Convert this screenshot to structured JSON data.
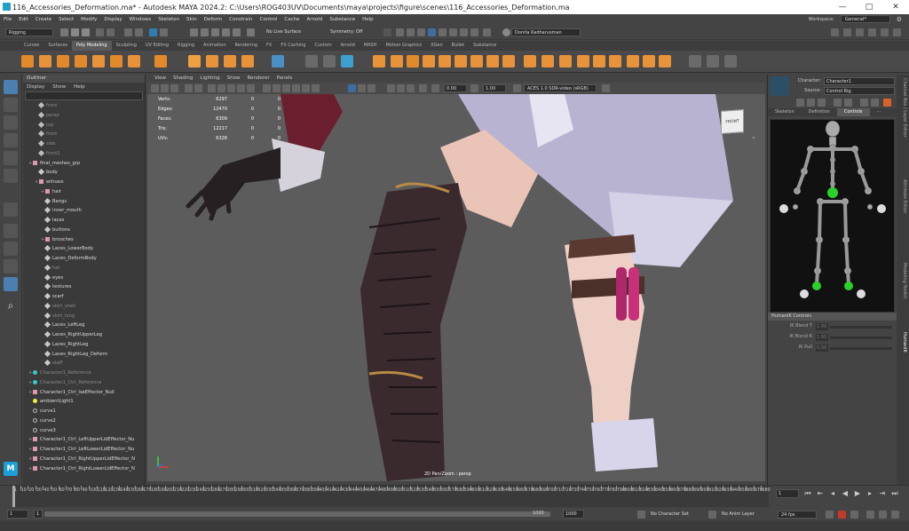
{
  "window": {
    "title": "116_Accessories_Deformation.ma* - Autodesk MAYA 2024.2: C:\\Users\\ROG403UV\\Documents\\maya\\projects\\figure\\scenes\\116_Accessories_Deformation.ma",
    "min": "—",
    "max": "□",
    "close": "✕"
  },
  "menus": [
    "File",
    "Edit",
    "Create",
    "Select",
    "Modify",
    "Display",
    "Windows",
    "Skeleton",
    "Skin",
    "Deform",
    "Constrain",
    "Control",
    "Cache",
    "Arnold",
    "Substance",
    "Help"
  ],
  "workspace": {
    "label": "Workspace:",
    "value": "General*"
  },
  "status_line": {
    "menu_set": "Rigging",
    "live_surface": "No Live Surface",
    "symmetry": "Symmetry: Off",
    "user": "Donita Kadharusman"
  },
  "shelf_tabs": [
    "Curves",
    "Surfaces",
    "Poly Modeling",
    "Sculpting",
    "UV Editing",
    "Rigging",
    "Animation",
    "Rendering",
    "FX",
    "FX Caching",
    "Custom",
    "Arnold",
    "MASH",
    "Motion Graphics",
    "XGen",
    "Bullet",
    "Substance"
  ],
  "shelf_active": "Poly Modeling",
  "outliner": {
    "title": "Outliner",
    "menu": [
      "Display",
      "Show",
      "Help"
    ],
    "rows": [
      {
        "label": "front",
        "depth": 1,
        "icon": "camera",
        "dim": true
      },
      {
        "label": "persp",
        "depth": 1,
        "icon": "camera",
        "dim": true
      },
      {
        "label": "top",
        "depth": 1,
        "icon": "camera",
        "dim": true
      },
      {
        "label": "front",
        "depth": 1,
        "icon": "camera",
        "dim": true
      },
      {
        "label": "side",
        "depth": 1,
        "icon": "camera",
        "dim": true
      },
      {
        "label": "front1",
        "depth": 1,
        "icon": "camera",
        "dim": true
      },
      {
        "label": "final_meshes_grp",
        "depth": 0,
        "icon": "grp",
        "dim": false
      },
      {
        "label": "body",
        "depth": 1,
        "icon": "mesh",
        "dim": false
      },
      {
        "label": "witnass",
        "depth": 1,
        "icon": "grp",
        "dim": false
      },
      {
        "label": "hair",
        "depth": 2,
        "icon": "grp",
        "dim": false
      },
      {
        "label": "Bangs",
        "depth": 2,
        "icon": "mesh",
        "dim": false
      },
      {
        "label": "inner_mouth",
        "depth": 2,
        "icon": "mesh",
        "dim": false
      },
      {
        "label": "laces",
        "depth": 2,
        "icon": "mesh",
        "dim": false
      },
      {
        "label": "buttons",
        "depth": 2,
        "icon": "mesh",
        "dim": false
      },
      {
        "label": "brooches",
        "depth": 2,
        "icon": "grp",
        "dim": false
      },
      {
        "label": "Laces_LowerBody",
        "depth": 2,
        "icon": "mesh",
        "dim": false
      },
      {
        "label": "Laces_DeformBody",
        "depth": 2,
        "icon": "mesh",
        "dim": false
      },
      {
        "label": "hat",
        "depth": 2,
        "icon": "mesh",
        "dim": true
      },
      {
        "label": "eyes",
        "depth": 2,
        "icon": "mesh",
        "dim": false
      },
      {
        "label": "textures",
        "depth": 2,
        "icon": "mesh",
        "dim": false
      },
      {
        "label": "scarf",
        "depth": 2,
        "icon": "mesh",
        "dim": false
      },
      {
        "label": "skirt_shell",
        "depth": 2,
        "icon": "mesh",
        "dim": true
      },
      {
        "label": "skirt_long",
        "depth": 2,
        "icon": "mesh",
        "dim": true
      },
      {
        "label": "Laces_LeftLeg",
        "depth": 2,
        "icon": "mesh",
        "dim": false
      },
      {
        "label": "Laces_RightUpperLeg",
        "depth": 2,
        "icon": "mesh",
        "dim": false
      },
      {
        "label": "Laces_RightLeg",
        "depth": 2,
        "icon": "mesh",
        "dim": false
      },
      {
        "label": "Laces_RightLeg_Deform",
        "depth": 2,
        "icon": "mesh",
        "dim": false
      },
      {
        "label": "staff",
        "depth": 2,
        "icon": "mesh",
        "dim": true
      },
      {
        "label": "Character1_Reference",
        "depth": 0,
        "icon": "joint",
        "dim": true
      },
      {
        "label": "Character1_Ctrl_Reference",
        "depth": 0,
        "icon": "joint",
        "dim": true
      },
      {
        "label": "Character1_Ctrl_IseEffector_Null",
        "depth": 0,
        "icon": "grp",
        "dim": false
      },
      {
        "label": "ambientLight1",
        "depth": 0,
        "icon": "light",
        "dim": false
      },
      {
        "label": "curve1",
        "depth": 0,
        "icon": "curve",
        "dim": false
      },
      {
        "label": "curve2",
        "depth": 0,
        "icon": "curve",
        "dim": false
      },
      {
        "label": "curve3",
        "depth": 0,
        "icon": "curve",
        "dim": false
      },
      {
        "label": "Character1_Ctrl_LeftUpperLidEffector_Nu",
        "depth": 0,
        "icon": "grp",
        "dim": false
      },
      {
        "label": "Character1_Ctrl_LeftLowerLidEffector_Nu",
        "depth": 0,
        "icon": "grp",
        "dim": false
      },
      {
        "label": "Character1_Ctrl_RightUpperLidEffector_N",
        "depth": 0,
        "icon": "grp",
        "dim": false
      },
      {
        "label": "Character1_Ctrl_RightLowerLidEffector_N",
        "depth": 0,
        "icon": "grp",
        "dim": false
      }
    ]
  },
  "viewport": {
    "menu": [
      "View",
      "Shading",
      "Lighting",
      "Show",
      "Renderer",
      "Panels"
    ],
    "exposure": "0.00",
    "gamma": "1.00",
    "colorspace": "ACES 1.0 SDR-video (sRGB)",
    "hud": [
      {
        "label": "Verts:",
        "value": "6297",
        "a": "0",
        "b": "0"
      },
      {
        "label": "Edges:",
        "value": "12470",
        "a": "0",
        "b": "0"
      },
      {
        "label": "Faces:",
        "value": "6309",
        "a": "0",
        "b": "0"
      },
      {
        "label": "Tris:",
        "value": "12217",
        "a": "0",
        "b": "0"
      },
      {
        "label": "UVs:",
        "value": "6328",
        "a": "0",
        "b": "0"
      }
    ],
    "panzoom": "2D Pan/Zoom : persp",
    "viewcube": "FRONT"
  },
  "humanik": {
    "character_label": "Character:",
    "character": "Character1",
    "source_label": "Source:",
    "source": "Control Rig",
    "tabs": [
      "Skeleton",
      "Definition",
      "Controls"
    ],
    "active_tab": "Controls",
    "controls_header": "HumanIK Controls",
    "sliders": [
      {
        "label": "IK Blend T",
        "value": "1.00"
      },
      {
        "label": "IK Blend R",
        "value": "1.00"
      },
      {
        "label": "IK Pull",
        "value": "0.00"
      }
    ]
  },
  "side_tabs": [
    "Channel Box / Layer Editor",
    "Attribute Editor",
    "Modeling Toolkit",
    "HumanIK"
  ],
  "timeslider": {
    "ticks": [
      1,
      10,
      20,
      30,
      40,
      50,
      60,
      70,
      80,
      90,
      100,
      110,
      120,
      130,
      140,
      150,
      160,
      170,
      180,
      190,
      200,
      210,
      220,
      230,
      240,
      250,
      260,
      270,
      280,
      290,
      300,
      310,
      320,
      330,
      340,
      350,
      360,
      370,
      380,
      390,
      400,
      410,
      420,
      430,
      440,
      450,
      460,
      470,
      480,
      490,
      500,
      510,
      520,
      530,
      540,
      550,
      560,
      570,
      580,
      590,
      600,
      610,
      620,
      630,
      640,
      650,
      660,
      670,
      680,
      690,
      700,
      710,
      720,
      730,
      740,
      750,
      760,
      770,
      780,
      790,
      800,
      810,
      820,
      830,
      840,
      850,
      860,
      870,
      880,
      890,
      900,
      910,
      920,
      930,
      940,
      950,
      960,
      970,
      980
    ],
    "current_frame": "1"
  },
  "range": {
    "start": "1",
    "inner_start": "1",
    "end": "1000",
    "outer_end": "1000",
    "character_set": "No Character Set",
    "anim_layer": "No Anim Layer",
    "fps": "24 fps"
  }
}
